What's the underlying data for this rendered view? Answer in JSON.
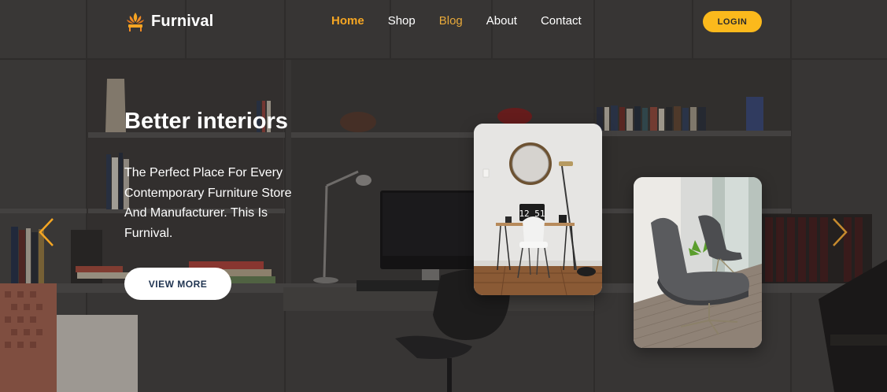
{
  "brand": {
    "name": "Furnival",
    "icon": "lotus-chair-icon"
  },
  "nav": {
    "items": [
      {
        "label": "Home",
        "state": "active"
      },
      {
        "label": "Shop",
        "state": "normal"
      },
      {
        "label": "Blog",
        "state": "hover"
      },
      {
        "label": "About",
        "state": "normal"
      },
      {
        "label": "Contact",
        "state": "normal"
      }
    ],
    "login_label": "LOGIN"
  },
  "hero": {
    "title": "Better interiors",
    "description": "The Perfect Place For Every Contemporary Furniture Store And Manufacturer. This Is Furnival.",
    "cta_label": "VIEW MORE"
  },
  "slider": {
    "prev_icon": "chevron-left-icon",
    "next_icon": "chevron-right-icon"
  },
  "cards": [
    {
      "name": "desk-setup",
      "clock_text": "12 51"
    },
    {
      "name": "lounge-chairs"
    }
  ],
  "colors": {
    "accent": "#fbb91c",
    "nav_active": "#f5a623",
    "text_light": "#ffffff",
    "cta_text": "#1f3350"
  }
}
